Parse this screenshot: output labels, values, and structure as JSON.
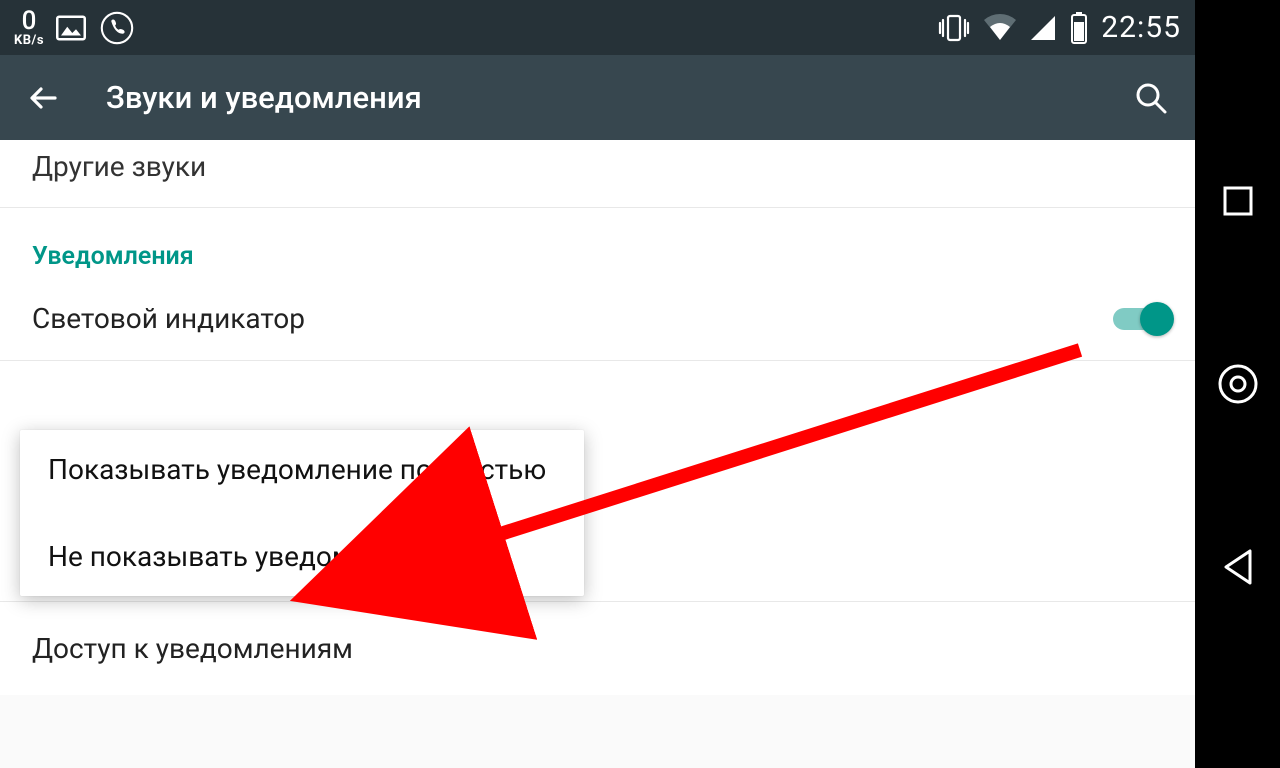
{
  "status": {
    "speed_value": "0",
    "speed_unit": "KB/s",
    "time": "22:55"
  },
  "action_bar": {
    "title": "Звуки и уведомления"
  },
  "items": {
    "other_sounds": "Другие звуки",
    "section_notifications": "Уведомления",
    "led_indicator": "Световой индикатор",
    "notification_access": "Доступ к уведомлениям"
  },
  "popup": {
    "option_full": "Показывать уведомление полностью",
    "option_none": "Не показывать уведомления"
  }
}
